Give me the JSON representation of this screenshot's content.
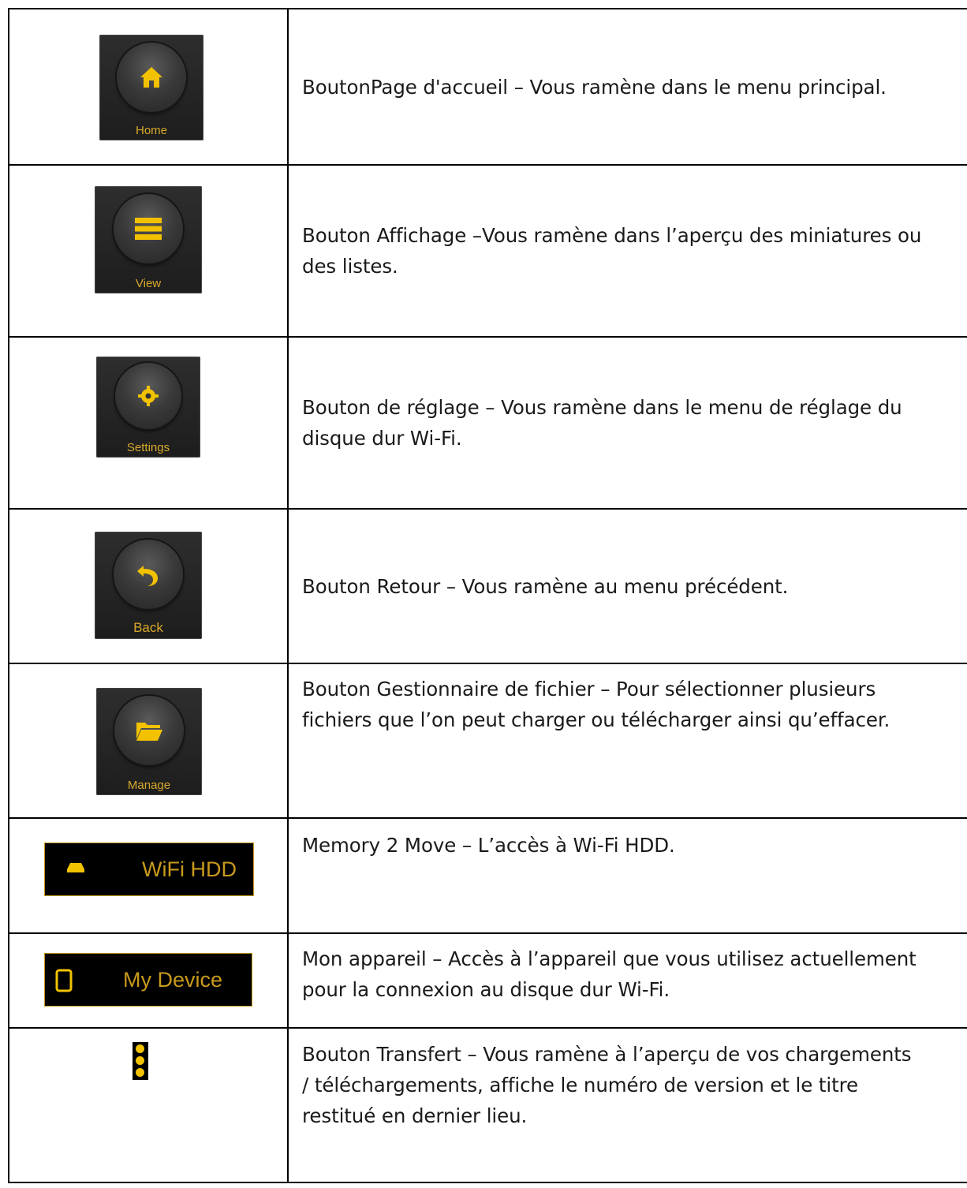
{
  "rows": [
    {
      "icon": "home-icon",
      "caption": "Home",
      "text": "BoutonPage d'accueil – Vous ramène dans le menu principal."
    },
    {
      "icon": "view-menu-icon",
      "caption": "View",
      "text": "Bouton Affichage –Vous ramène dans l’aperçu des miniatures ou\ndes listes."
    },
    {
      "icon": "settings-gear-icon",
      "caption": "Settings",
      "text": "Bouton de réglage – Vous ramène dans le menu de réglage du\ndisque dur Wi-Fi."
    },
    {
      "icon": "back-arrow-icon",
      "caption": "Back",
      "text": "Bouton Retour – Vous ramène au menu précédent."
    },
    {
      "icon": "folder-icon",
      "caption": "Manage",
      "text": "Bouton Gestionnaire de fichier – Pour sélectionner plusieurs\nfichiers que l’on peut charger ou télécharger ainsi qu’effacer."
    },
    {
      "icon": "hdd-icon",
      "caption": "WiFi HDD",
      "text": "Memory 2 Move – L’accès à Wi-Fi HDD."
    },
    {
      "icon": "tablet-icon",
      "caption": "My Device",
      "text": "Mon appareil – Accès à l’appareil que vous utilisez actuellement\npour la connexion au disque dur Wi-Fi."
    },
    {
      "icon": "vertical-dots-icon",
      "caption": "",
      "text": "Bouton Transfert – Vous ramène à l’aperçu de vos chargements\n/ téléchargements, affiche le numéro de version et le titre\nrestitué en dernier lieu."
    }
  ],
  "colors": {
    "accent": "#f2c200",
    "caption": "#d9a92a",
    "tile": "#262626",
    "bar_border": "#c89a1c"
  }
}
